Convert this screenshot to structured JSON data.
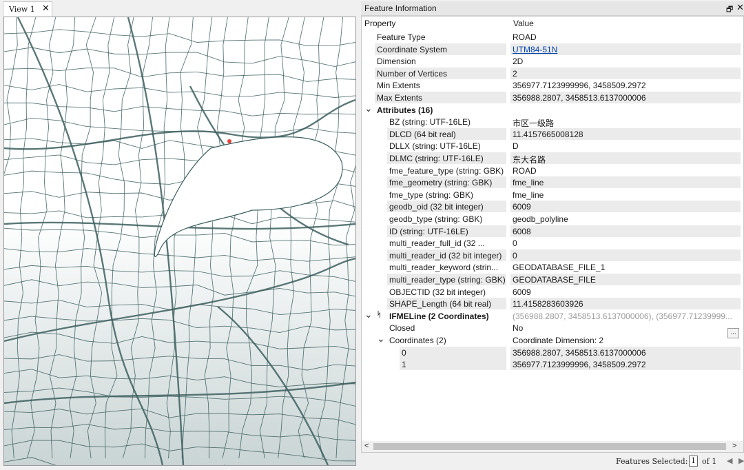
{
  "view_tab": {
    "label": "View 1",
    "close": "✕"
  },
  "panel": {
    "title": "Feature Information",
    "pin": "🗗",
    "close": "✕"
  },
  "columns": {
    "property": "Property",
    "value": "Value"
  },
  "general_rows": [
    {
      "property": "Feature Type",
      "value": "ROAD"
    },
    {
      "property": "Coordinate System",
      "value": "UTM84-51N",
      "link": true
    },
    {
      "property": "Dimension",
      "value": "2D"
    },
    {
      "property": "Number of Vertices",
      "value": "2"
    },
    {
      "property": "Min Extents",
      "value": "356977.7123999996, 3458509.2972"
    },
    {
      "property": "Max Extents",
      "value": "356988.2807, 3458513.6137000006"
    }
  ],
  "attributes_header": "Attributes (16)",
  "attributes": [
    {
      "property": "BZ (string: UTF-16LE)",
      "value": "市区一级路"
    },
    {
      "property": "DLCD (64 bit real)",
      "value": "11.4157665008128"
    },
    {
      "property": "DLLX (string: UTF-16LE)",
      "value": "D"
    },
    {
      "property": "DLMC (string: UTF-16LE)",
      "value": "东大名路"
    },
    {
      "property": "fme_feature_type (string: GBK)",
      "value": "ROAD"
    },
    {
      "property": "fme_geometry (string: GBK)",
      "value": "fme_line"
    },
    {
      "property": "fme_type (string: GBK)",
      "value": "fme_line"
    },
    {
      "property": "geodb_oid (32 bit integer)",
      "value": "6009"
    },
    {
      "property": "geodb_type (string: GBK)",
      "value": "geodb_polyline"
    },
    {
      "property": "ID (string: UTF-16LE)",
      "value": "6008"
    },
    {
      "property": "multi_reader_full_id (32 ...",
      "value": "0"
    },
    {
      "property": "multi_reader_id (32 bit integer)",
      "value": "0"
    },
    {
      "property": "multi_reader_keyword (strin...",
      "value": "GEODATABASE_FILE_1"
    },
    {
      "property": "multi_reader_type (string: GBK)",
      "value": "GEODATABASE_FILE"
    },
    {
      "property": "OBJECTID (32 bit integer)",
      "value": "6009"
    },
    {
      "property": "SHAPE_Length (64 bit real)",
      "value": "11.4158283603926"
    }
  ],
  "geometry": {
    "header": "IFMELine (2 Coordinates)",
    "summary": "(356988.2807, 3458513.6137000006), (356977.71239999...",
    "more": "...",
    "closed_label": "Closed",
    "closed_value": "No",
    "coords_label": "Coordinates (2)",
    "coords_value": "Coordinate Dimension: 2",
    "coords": [
      {
        "index": "0",
        "value": "356988.2807, 3458513.6137000006"
      },
      {
        "index": "1",
        "value": "356977.7123999996, 3458509.2972"
      }
    ]
  },
  "status": {
    "label": "Features Selected:",
    "selected": "1",
    "of": "of 1",
    "prev": "◀",
    "next": "▶"
  },
  "scroll": {
    "left": "<",
    "right": ">"
  },
  "colors": {
    "road": "#3d5f5f",
    "highlight": "#e8403a",
    "row_alt": "#ebebeb",
    "link": "#0645ad"
  }
}
